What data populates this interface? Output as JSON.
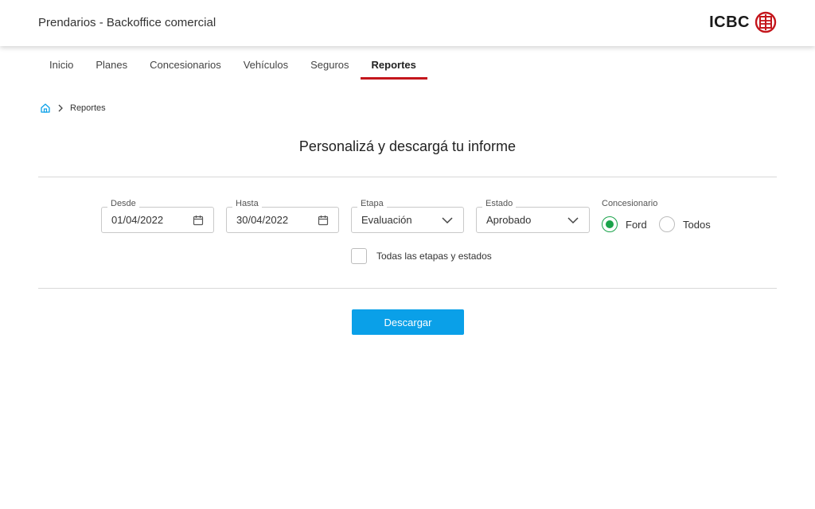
{
  "header": {
    "app_title": "Prendarios - Backoffice comercial",
    "logo_text": "ICBC",
    "brand_color": "#c4161c"
  },
  "nav": {
    "items": [
      {
        "label": "Inicio",
        "active": false
      },
      {
        "label": "Planes",
        "active": false
      },
      {
        "label": "Concesionarios",
        "active": false
      },
      {
        "label": "Vehículos",
        "active": false
      },
      {
        "label": "Seguros",
        "active": false
      },
      {
        "label": "Reportes",
        "active": true
      }
    ]
  },
  "breadcrumb": {
    "home_icon": "home-icon",
    "current": "Reportes"
  },
  "page": {
    "title": "Personalizá y descargá tu informe"
  },
  "filters": {
    "desde": {
      "label": "Desde",
      "value": "01/04/2022",
      "icon": "calendar-icon"
    },
    "hasta": {
      "label": "Hasta",
      "value": "30/04/2022",
      "icon": "calendar-icon"
    },
    "etapa": {
      "label": "Etapa",
      "value": "Evaluación",
      "icon": "chevron-down-icon"
    },
    "estado": {
      "label": "Estado",
      "value": "Aprobado",
      "icon": "chevron-down-icon"
    },
    "concesionario": {
      "label": "Concesionario",
      "options": [
        {
          "label": "Ford",
          "checked": true
        },
        {
          "label": "Todos",
          "checked": false
        }
      ],
      "checked_color": "#1aa34a"
    },
    "all_stages": {
      "label": "Todas las etapas y estados",
      "checked": false
    }
  },
  "actions": {
    "download_label": "Descargar",
    "download_color": "#0aa0e8"
  }
}
